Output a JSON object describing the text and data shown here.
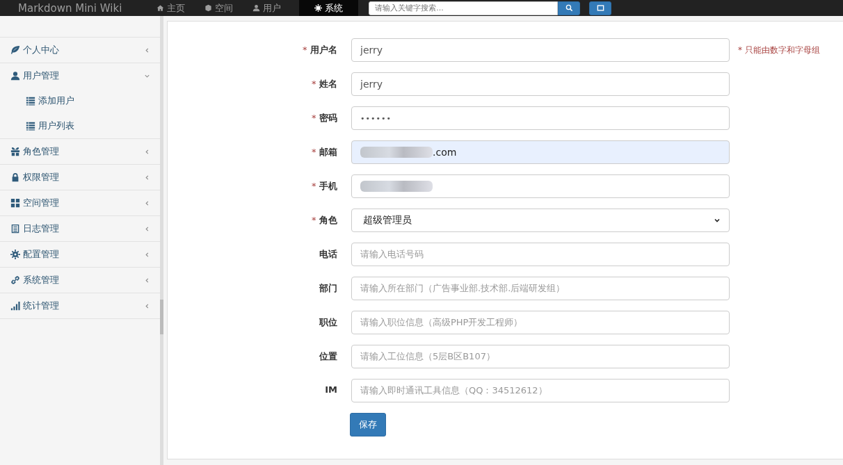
{
  "navbar": {
    "brand": "Markdown Mini Wiki",
    "items": [
      {
        "label": "主页",
        "selected": false
      },
      {
        "label": "空间",
        "selected": false
      },
      {
        "label": "用户",
        "selected": false
      },
      {
        "label": "系统",
        "selected": true
      }
    ],
    "search": {
      "placeholder": "请输入关键字搜索..."
    }
  },
  "sidebar": {
    "items": [
      {
        "label": "个人中心",
        "expanded": false
      },
      {
        "label": "用户管理",
        "expanded": true,
        "children": [
          {
            "label": "添加用户"
          },
          {
            "label": "用户列表"
          }
        ]
      },
      {
        "label": "角色管理",
        "expanded": false
      },
      {
        "label": "权限管理",
        "expanded": false
      },
      {
        "label": "空间管理",
        "expanded": false
      },
      {
        "label": "日志管理",
        "expanded": false
      },
      {
        "label": "配置管理",
        "expanded": false
      },
      {
        "label": "系统管理",
        "expanded": false
      },
      {
        "label": "统计管理",
        "expanded": false
      }
    ]
  },
  "form": {
    "fields": [
      {
        "label": "用户名",
        "required_mark": "*",
        "kind": "text",
        "value": "jerry",
        "hint": "* 只能由数字和字母组"
      },
      {
        "label": "姓名",
        "required_mark": "*",
        "kind": "text",
        "value": "jerry"
      },
      {
        "label": "密码",
        "required_mark": "*",
        "kind": "password",
        "value": "••••••"
      },
      {
        "label": "邮箱",
        "required_mark": "*",
        "kind": "text",
        "value": ".com",
        "redacted": true,
        "autofilled": true
      },
      {
        "label": "手机",
        "required_mark": "*",
        "kind": "text",
        "redacted": true
      },
      {
        "label": "角色",
        "required_mark": "*",
        "kind": "select",
        "value": "超级管理员"
      },
      {
        "label": "电话",
        "kind": "text",
        "placeholder": "请输入电话号码"
      },
      {
        "label": "部门",
        "kind": "text",
        "placeholder": "请输入所在部门（广告事业部.技术部.后端研发组）"
      },
      {
        "label": "职位",
        "kind": "text",
        "placeholder": "请输入职位信息（高级PHP开发工程师）"
      },
      {
        "label": "位置",
        "kind": "text",
        "placeholder": "请输入工位信息（5层B区B107）"
      },
      {
        "label": "IM",
        "kind": "text",
        "placeholder": "请输入即时通讯工具信息（QQ：34512612）"
      }
    ],
    "submit": "保存"
  }
}
